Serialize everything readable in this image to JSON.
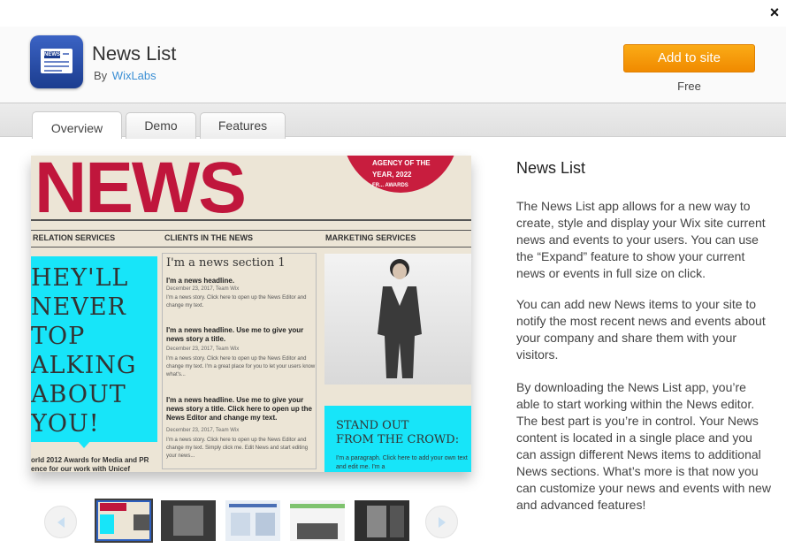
{
  "dialog": {
    "close_glyph": "×"
  },
  "app": {
    "title": "News List",
    "by_label": "By",
    "developer": "WixLabs",
    "add_button_label": "Add to site",
    "price": "Free",
    "icon_text": "NEWS"
  },
  "tabs": [
    {
      "label": "Overview",
      "active": true
    },
    {
      "label": "Demo",
      "active": false
    },
    {
      "label": "Features",
      "active": false
    }
  ],
  "preview": {
    "masthead": "NEWS",
    "badge_line1": "AGENCY OF THE",
    "badge_line2": "YEAR, 2022",
    "badge_line3": "FR... AWARDS",
    "sections": [
      "RELATION SERVICES",
      "CLIENTS IN THE NEWS",
      "MARKETING SERVICES"
    ],
    "quote_lines": [
      "HEY'LL",
      "NEVER",
      "TOP",
      "ALKING",
      "ABOUT",
      "YOU!"
    ],
    "footer_line1": "orld 2012 Awards for Media and PR",
    "footer_line2": "ence for our work with Unicef",
    "mid_heading": "I'm a news section 1",
    "items": [
      {
        "headline": "I'm a news headline.",
        "meta": "December 23, 2017, Team Wix",
        "body": "I'm a news story. Click here to open up the News Editor and change my text."
      },
      {
        "headline": "I'm a news headline. Use me to give your news story a title.",
        "meta": "December 23, 2017, Team Wix",
        "body": "I'm a news story. Click here to open up the News Editor and change my text. I'm a great place for you to let your users know what's..."
      },
      {
        "headline": "I'm a news headline. Use me to give your news story a title. Click here to open up the News Editor and change my text.",
        "meta": "December 23, 2017, Team Wix",
        "body": "I'm a news story. Click here to open up the News Editor and change my text. Simply click me. Edit News and start editing your news..."
      }
    ],
    "standout_line1": "STAND OUT",
    "standout_line2": "FROM THE CROWD:",
    "para": "I'm a paragraph. Click here to add your own text and edit me. I'm a"
  },
  "thumbnails": [
    "thumb-1",
    "thumb-2",
    "thumb-3",
    "thumb-4",
    "thumb-5"
  ],
  "description": {
    "title": "News List",
    "paragraphs": [
      "The News List app allows for a new way to create, style and display your Wix site current news and events to your users. You can use the “Expand” feature to show your current news or events in full size on click.",
      "You can add new News items to your site to notify the most recent news and events about your company and share them with your visitors.",
      "By downloading the News List app, you’re able to start working within the News editor. The best part is you’re in control. Your News content is located in a single place and you can assign different News items to additional News sections. What’s more is that now you can customize your news and events with new and advanced features!"
    ]
  },
  "colors": {
    "accent_orange": "#f59a0a",
    "link_blue": "#3b8fd4",
    "selected_thumb": "#2d5fbf"
  }
}
